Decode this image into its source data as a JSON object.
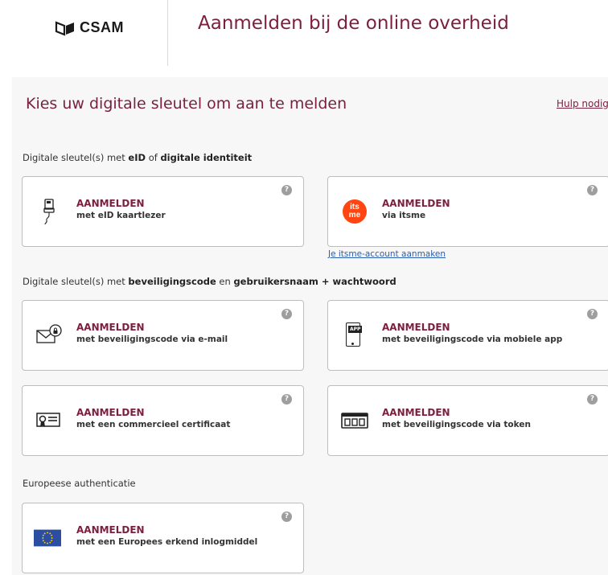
{
  "header": {
    "logo_text": "CSAM",
    "title": "Aanmelden bij de online overheid"
  },
  "main": {
    "title": "Kies uw digitale sleutel om aan te melden",
    "help_link": "Hulp nodig?"
  },
  "sections": {
    "eid": {
      "pre": "Digitale sleutel(s) met ",
      "b1": "eID",
      "mid": " of ",
      "b2": "digitale identiteit"
    },
    "code": {
      "pre": "Digitale sleutel(s) met ",
      "b1": "beveiligingscode",
      "mid": " en ",
      "b2": "gebruikersnaam + wachtwoord"
    },
    "euro": {
      "label": "Europeese authenticatie"
    }
  },
  "cards": {
    "eid_reader": {
      "title": "AANMELDEN",
      "subtitle": "met eID kaartlezer",
      "icon": "eid-card-reader-icon"
    },
    "itsme": {
      "title": "AANMELDEN",
      "subtitle": "via itsme",
      "icon": "itsme-logo-icon",
      "logo_line1": "its",
      "logo_line2": "me"
    },
    "email": {
      "title": "AANMELDEN",
      "subtitle": "met beveiligingscode via e-mail",
      "icon": "envelope-lock-icon"
    },
    "mobile_app": {
      "title": "AANMELDEN",
      "subtitle": "met beveiligingscode via mobiele app",
      "icon": "mobile-app-icon",
      "app_badge": "APP"
    },
    "certificate": {
      "title": "AANMELDEN",
      "subtitle": "met een commercieel certificaat",
      "icon": "certificate-icon"
    },
    "token": {
      "title": "AANMELDEN",
      "subtitle": "met beveiligingscode via token",
      "icon": "token-icon"
    },
    "european": {
      "title": "AANMELDEN",
      "subtitle": "met een Europees erkend inlogmiddel",
      "icon": "eu-flag-icon"
    }
  },
  "help_icon_glyph": "?",
  "itsme_account_link": "Je itsme-account aanmaken",
  "colors": {
    "accent": "#7a1f3d",
    "link": "#2a5db0",
    "itsme": "#ff4612",
    "eu_blue": "#2b4ea2",
    "eu_yellow": "#ffcc00"
  }
}
